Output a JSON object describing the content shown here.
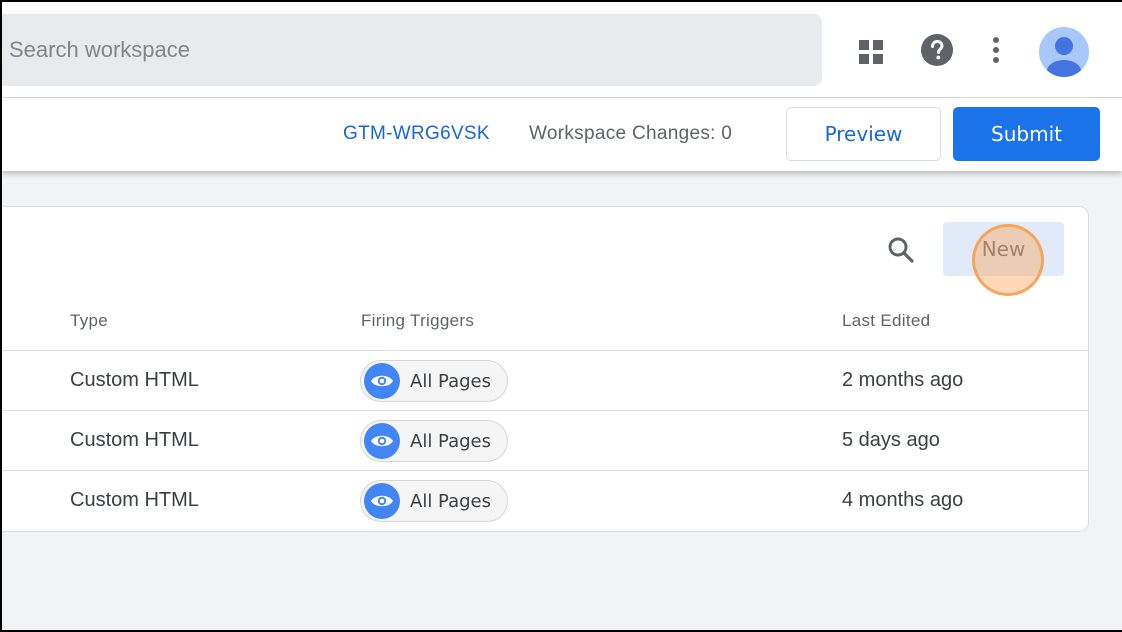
{
  "header": {
    "search_placeholder": "Search workspace",
    "icons": [
      "apps-icon",
      "help-icon",
      "more-vert-icon",
      "account-avatar"
    ]
  },
  "toolbar": {
    "container_id": "GTM-WRG6VSK",
    "workspace_changes": "Workspace Changes: 0",
    "preview_label": "Preview",
    "submit_label": "Submit"
  },
  "tags_card": {
    "new_label": "New",
    "columns": {
      "type": "Type",
      "firing_triggers": "Firing Triggers",
      "last_edited": "Last Edited"
    },
    "rows": [
      {
        "type": "Custom HTML",
        "trigger": "All Pages",
        "last_edited": "2 months ago"
      },
      {
        "type": "Custom HTML",
        "trigger": "All Pages",
        "last_edited": "5 days ago"
      },
      {
        "type": "Custom HTML",
        "trigger": "All Pages",
        "last_edited": "4 months ago"
      }
    ]
  },
  "colors": {
    "primary": "#1a73e8",
    "link": "#1967d2",
    "trigger_icon": "#4285f4",
    "click_highlight": "#f5a050"
  }
}
